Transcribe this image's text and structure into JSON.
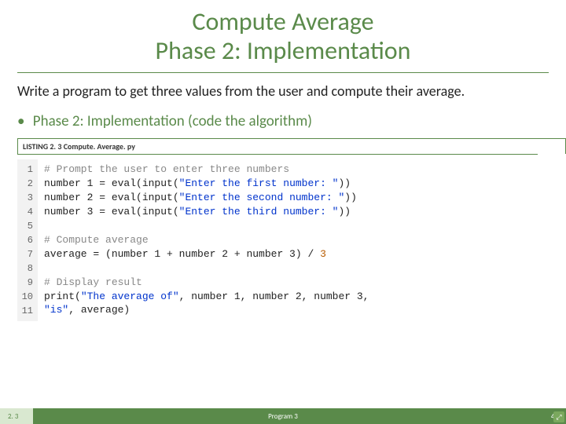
{
  "title": {
    "line1": "Compute Average",
    "line2": "Phase 2: Implementation"
  },
  "intro": "Write a program to get three values from the user and compute their average.",
  "bullet": "Phase 2: Implementation (code the algorithm)",
  "listing_label": "LISTING 2. 3 Compute. Average. py",
  "line_numbers": [
    "1",
    "2",
    "3",
    "4",
    "5",
    "6",
    "7",
    "8",
    "9",
    "10",
    "11"
  ],
  "code": {
    "l1_a": "# Prompt the user to enter three numbers",
    "l2_a": "number 1 = eval(input(",
    "l2_str": "\"Enter the first number: \"",
    "l2_b": "))",
    "l3_a": "number 2 = eval(input(",
    "l3_str": "\"Enter the second number: \"",
    "l3_b": "))",
    "l4_a": "number 3 = eval(input(",
    "l4_str": "\"Enter the third number: \"",
    "l4_b": "))",
    "l5": "",
    "l6": "# Compute average",
    "l7_a": "average = (number 1 + number 2 + number 3) / ",
    "l7_num": "3",
    "l8": "",
    "l9": "# Display result",
    "l10_a": "print(",
    "l10_str": "\"The average of\"",
    "l10_b": ", number 1, number 2, number 3,",
    "l11_str": "\"is\"",
    "l11_b": ", average)"
  },
  "footer": {
    "left": "2. 3",
    "mid": "Program 3",
    "right": "47"
  }
}
